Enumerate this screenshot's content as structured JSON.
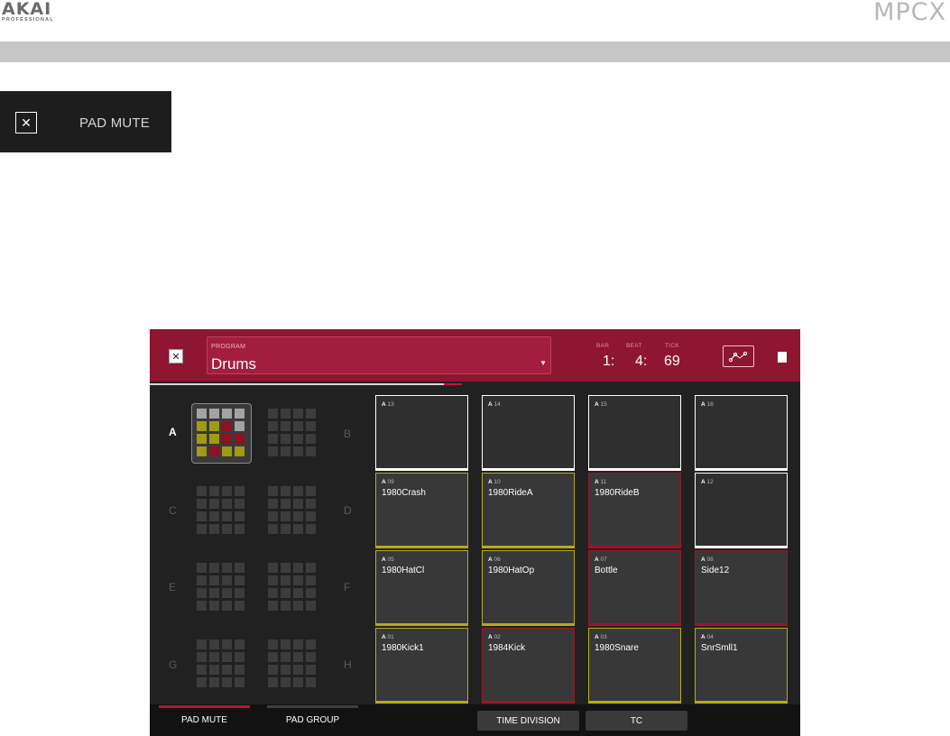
{
  "header": {
    "brand": "AKAI",
    "brand_sub": "PROFESSIONAL",
    "product": "MPCX"
  },
  "callout": {
    "icon": "close-icon",
    "label": "PAD MUTE"
  },
  "screen": {
    "topbar": {
      "close_icon": "close-icon",
      "program_label": "PROGRAM",
      "program_value": "Drums",
      "bar_label": "BAR",
      "beat_label": "BEAT",
      "tick_label": "TICK",
      "bar_value": "1:",
      "beat_value": "4:",
      "tick_value": "69",
      "automation_icon": "automation-icon",
      "chip_icon": "chip-icon"
    },
    "banks": [
      "A",
      "B",
      "C",
      "D",
      "E",
      "F",
      "G",
      "H"
    ],
    "active_bank": "A",
    "bank_a_colors": [
      [
        "#a3a3a3",
        "#a3a3a3",
        "#a3a3a3",
        "#a3a3a3"
      ],
      [
        "#a19a12",
        "#a19a12",
        "#8e1124",
        "#a3a3a3"
      ],
      [
        "#a19a12",
        "#a19a12",
        "#8e1124",
        "#8e1124"
      ],
      [
        "#a19a12",
        "#8e1124",
        "#a19a12",
        "#a19a12"
      ]
    ],
    "pads": [
      {
        "bank": "A",
        "num": "13",
        "name": "",
        "state": "plain"
      },
      {
        "bank": "A",
        "num": "14",
        "name": "",
        "state": "plain"
      },
      {
        "bank": "A",
        "num": "15",
        "name": "",
        "state": "plain"
      },
      {
        "bank": "A",
        "num": "16",
        "name": "",
        "state": "plain"
      },
      {
        "bank": "A",
        "num": "09",
        "name": "1980Crash",
        "state": "yellow"
      },
      {
        "bank": "A",
        "num": "10",
        "name": "1980RideA",
        "state": "yellow"
      },
      {
        "bank": "A",
        "num": "11",
        "name": "1980RideB",
        "state": "red"
      },
      {
        "bank": "A",
        "num": "12",
        "name": "",
        "state": "plain"
      },
      {
        "bank": "A",
        "num": "05",
        "name": "1980HatCl",
        "state": "yellow"
      },
      {
        "bank": "A",
        "num": "06",
        "name": "1980HatOp",
        "state": "yellow"
      },
      {
        "bank": "A",
        "num": "07",
        "name": "Bottle",
        "state": "red"
      },
      {
        "bank": "A",
        "num": "08",
        "name": "Side12",
        "state": "red"
      },
      {
        "bank": "A",
        "num": "01",
        "name": "1980Kick1",
        "state": "yellow"
      },
      {
        "bank": "A",
        "num": "02",
        "name": "1984Kick",
        "state": "red"
      },
      {
        "bank": "A",
        "num": "03",
        "name": "1980Snare",
        "state": "yellow"
      },
      {
        "bank": "A",
        "num": "04",
        "name": "SnrSmll1",
        "state": "yellow"
      }
    ],
    "tabs": {
      "pad_mute": "PAD MUTE",
      "pad_group": "PAD GROUP",
      "time_division": "TIME DIVISION",
      "tc": "TC"
    }
  }
}
